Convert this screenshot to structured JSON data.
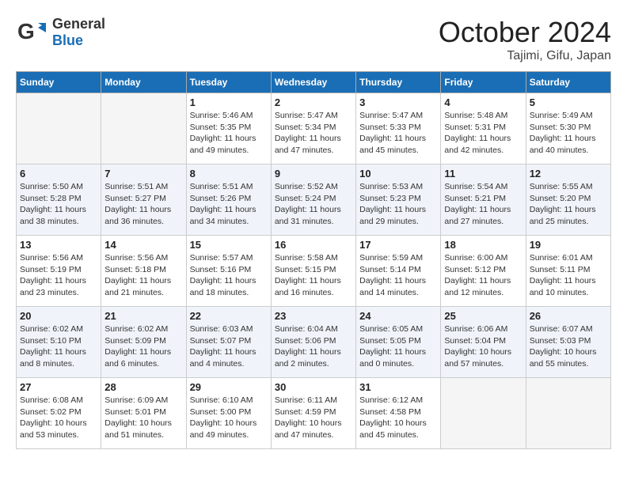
{
  "header": {
    "logo_general": "General",
    "logo_blue": "Blue",
    "month_title": "October 2024",
    "location": "Tajimi, Gifu, Japan"
  },
  "weekdays": [
    "Sunday",
    "Monday",
    "Tuesday",
    "Wednesday",
    "Thursday",
    "Friday",
    "Saturday"
  ],
  "weeks": [
    [
      {
        "day": "",
        "empty": true
      },
      {
        "day": "",
        "empty": true
      },
      {
        "day": "1",
        "sunrise": "Sunrise: 5:46 AM",
        "sunset": "Sunset: 5:35 PM",
        "daylight": "Daylight: 11 hours and 49 minutes."
      },
      {
        "day": "2",
        "sunrise": "Sunrise: 5:47 AM",
        "sunset": "Sunset: 5:34 PM",
        "daylight": "Daylight: 11 hours and 47 minutes."
      },
      {
        "day": "3",
        "sunrise": "Sunrise: 5:47 AM",
        "sunset": "Sunset: 5:33 PM",
        "daylight": "Daylight: 11 hours and 45 minutes."
      },
      {
        "day": "4",
        "sunrise": "Sunrise: 5:48 AM",
        "sunset": "Sunset: 5:31 PM",
        "daylight": "Daylight: 11 hours and 42 minutes."
      },
      {
        "day": "5",
        "sunrise": "Sunrise: 5:49 AM",
        "sunset": "Sunset: 5:30 PM",
        "daylight": "Daylight: 11 hours and 40 minutes."
      }
    ],
    [
      {
        "day": "6",
        "sunrise": "Sunrise: 5:50 AM",
        "sunset": "Sunset: 5:28 PM",
        "daylight": "Daylight: 11 hours and 38 minutes."
      },
      {
        "day": "7",
        "sunrise": "Sunrise: 5:51 AM",
        "sunset": "Sunset: 5:27 PM",
        "daylight": "Daylight: 11 hours and 36 minutes."
      },
      {
        "day": "8",
        "sunrise": "Sunrise: 5:51 AM",
        "sunset": "Sunset: 5:26 PM",
        "daylight": "Daylight: 11 hours and 34 minutes."
      },
      {
        "day": "9",
        "sunrise": "Sunrise: 5:52 AM",
        "sunset": "Sunset: 5:24 PM",
        "daylight": "Daylight: 11 hours and 31 minutes."
      },
      {
        "day": "10",
        "sunrise": "Sunrise: 5:53 AM",
        "sunset": "Sunset: 5:23 PM",
        "daylight": "Daylight: 11 hours and 29 minutes."
      },
      {
        "day": "11",
        "sunrise": "Sunrise: 5:54 AM",
        "sunset": "Sunset: 5:21 PM",
        "daylight": "Daylight: 11 hours and 27 minutes."
      },
      {
        "day": "12",
        "sunrise": "Sunrise: 5:55 AM",
        "sunset": "Sunset: 5:20 PM",
        "daylight": "Daylight: 11 hours and 25 minutes."
      }
    ],
    [
      {
        "day": "13",
        "sunrise": "Sunrise: 5:56 AM",
        "sunset": "Sunset: 5:19 PM",
        "daylight": "Daylight: 11 hours and 23 minutes."
      },
      {
        "day": "14",
        "sunrise": "Sunrise: 5:56 AM",
        "sunset": "Sunset: 5:18 PM",
        "daylight": "Daylight: 11 hours and 21 minutes."
      },
      {
        "day": "15",
        "sunrise": "Sunrise: 5:57 AM",
        "sunset": "Sunset: 5:16 PM",
        "daylight": "Daylight: 11 hours and 18 minutes."
      },
      {
        "day": "16",
        "sunrise": "Sunrise: 5:58 AM",
        "sunset": "Sunset: 5:15 PM",
        "daylight": "Daylight: 11 hours and 16 minutes."
      },
      {
        "day": "17",
        "sunrise": "Sunrise: 5:59 AM",
        "sunset": "Sunset: 5:14 PM",
        "daylight": "Daylight: 11 hours and 14 minutes."
      },
      {
        "day": "18",
        "sunrise": "Sunrise: 6:00 AM",
        "sunset": "Sunset: 5:12 PM",
        "daylight": "Daylight: 11 hours and 12 minutes."
      },
      {
        "day": "19",
        "sunrise": "Sunrise: 6:01 AM",
        "sunset": "Sunset: 5:11 PM",
        "daylight": "Daylight: 11 hours and 10 minutes."
      }
    ],
    [
      {
        "day": "20",
        "sunrise": "Sunrise: 6:02 AM",
        "sunset": "Sunset: 5:10 PM",
        "daylight": "Daylight: 11 hours and 8 minutes."
      },
      {
        "day": "21",
        "sunrise": "Sunrise: 6:02 AM",
        "sunset": "Sunset: 5:09 PM",
        "daylight": "Daylight: 11 hours and 6 minutes."
      },
      {
        "day": "22",
        "sunrise": "Sunrise: 6:03 AM",
        "sunset": "Sunset: 5:07 PM",
        "daylight": "Daylight: 11 hours and 4 minutes."
      },
      {
        "day": "23",
        "sunrise": "Sunrise: 6:04 AM",
        "sunset": "Sunset: 5:06 PM",
        "daylight": "Daylight: 11 hours and 2 minutes."
      },
      {
        "day": "24",
        "sunrise": "Sunrise: 6:05 AM",
        "sunset": "Sunset: 5:05 PM",
        "daylight": "Daylight: 11 hours and 0 minutes."
      },
      {
        "day": "25",
        "sunrise": "Sunrise: 6:06 AM",
        "sunset": "Sunset: 5:04 PM",
        "daylight": "Daylight: 10 hours and 57 minutes."
      },
      {
        "day": "26",
        "sunrise": "Sunrise: 6:07 AM",
        "sunset": "Sunset: 5:03 PM",
        "daylight": "Daylight: 10 hours and 55 minutes."
      }
    ],
    [
      {
        "day": "27",
        "sunrise": "Sunrise: 6:08 AM",
        "sunset": "Sunset: 5:02 PM",
        "daylight": "Daylight: 10 hours and 53 minutes."
      },
      {
        "day": "28",
        "sunrise": "Sunrise: 6:09 AM",
        "sunset": "Sunset: 5:01 PM",
        "daylight": "Daylight: 10 hours and 51 minutes."
      },
      {
        "day": "29",
        "sunrise": "Sunrise: 6:10 AM",
        "sunset": "Sunset: 5:00 PM",
        "daylight": "Daylight: 10 hours and 49 minutes."
      },
      {
        "day": "30",
        "sunrise": "Sunrise: 6:11 AM",
        "sunset": "Sunset: 4:59 PM",
        "daylight": "Daylight: 10 hours and 47 minutes."
      },
      {
        "day": "31",
        "sunrise": "Sunrise: 6:12 AM",
        "sunset": "Sunset: 4:58 PM",
        "daylight": "Daylight: 10 hours and 45 minutes."
      },
      {
        "day": "",
        "empty": true
      },
      {
        "day": "",
        "empty": true
      }
    ]
  ]
}
